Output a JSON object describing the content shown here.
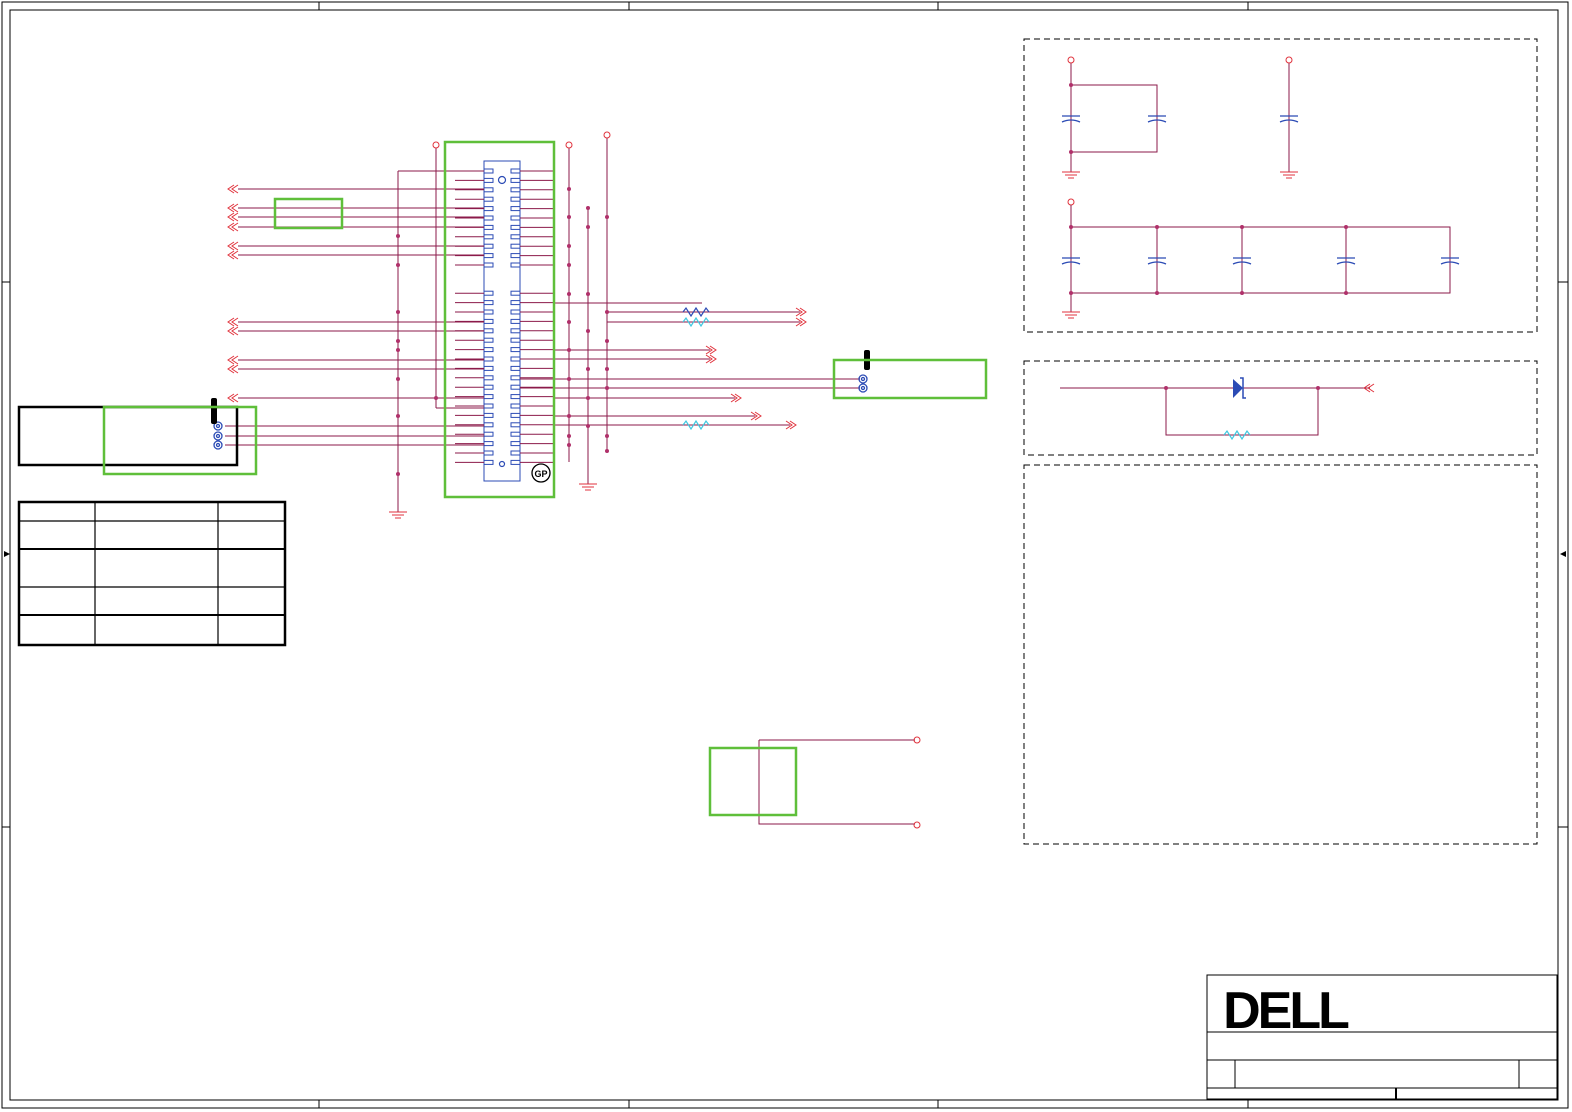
{
  "title_block": {
    "brand": "DELL"
  },
  "colors": {
    "wire": "#8b1a4a",
    "net_arrow": "#e0323c",
    "component": "#2b4bb5",
    "highlight_box": "#5fbf3a",
    "frame": "#000000",
    "dashed_box": "#000000",
    "resistor_alt": "#3ec8e0",
    "diode_fill": "#2b4bb5"
  },
  "icons": {
    "ground": "ground-icon",
    "power_port": "power-port-icon",
    "net_port": "off-page-connector-icon",
    "resistor": "resistor-icon",
    "capacitor": "capacitor-icon",
    "diode": "tvs-diode-icon",
    "gp_mark": "gp-mark-icon",
    "logo": "dell-logo-icon"
  },
  "markers": {
    "gp": "GP"
  }
}
